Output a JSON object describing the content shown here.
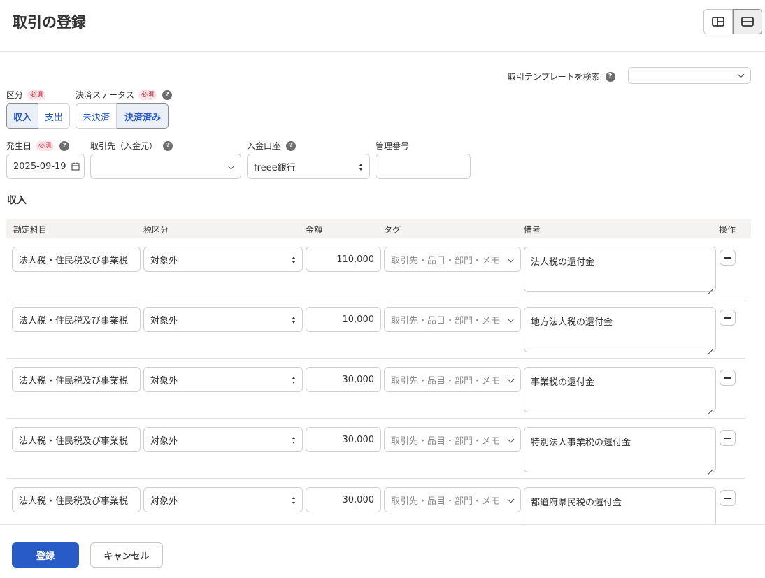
{
  "page": {
    "title": "取引の登録"
  },
  "colors": {
    "accent": "#285ac8",
    "required_bg": "#fde3e6",
    "required_text": "#c8283c"
  },
  "icons": {
    "view_split": "split-view-icon",
    "view_stack": "stacked-view-icon",
    "help": "question-icon",
    "calendar": "calendar-icon"
  },
  "template_search": {
    "label": "取引テンプレートを検索",
    "value": ""
  },
  "type": {
    "label": "区分",
    "required": "必須",
    "options": [
      "収入",
      "支出"
    ],
    "selected": "収入"
  },
  "status": {
    "label": "決済ステータス",
    "required": "必須",
    "options": [
      "未決済",
      "決済済み"
    ],
    "selected": "決済済み"
  },
  "date": {
    "label": "発生日",
    "required": "必須",
    "value": "2025-09-19"
  },
  "partner": {
    "label": "取引先（入金元）",
    "value": ""
  },
  "account": {
    "label": "入金口座",
    "value": "freee銀行"
  },
  "mgmt": {
    "label": "管理番号",
    "value": ""
  },
  "section": {
    "title": "収入"
  },
  "columns": {
    "account": "勘定科目",
    "tax": "税区分",
    "amount": "金額",
    "tag": "タグ",
    "memo": "備考",
    "ops": "操作"
  },
  "rows": [
    {
      "account": "法人税・住民税及び事業税",
      "tax": "対象外",
      "amount": "110,000",
      "tag_placeholder": "取引先・品目・部門・メモ",
      "memo": "法人税の還付金"
    },
    {
      "account": "法人税・住民税及び事業税",
      "tax": "対象外",
      "amount": "10,000",
      "tag_placeholder": "取引先・品目・部門・メモ",
      "memo": "地方法人税の還付金"
    },
    {
      "account": "法人税・住民税及び事業税",
      "tax": "対象外",
      "amount": "30,000",
      "tag_placeholder": "取引先・品目・部門・メモ",
      "memo": "事業税の還付金"
    },
    {
      "account": "法人税・住民税及び事業税",
      "tax": "対象外",
      "amount": "30,000",
      "tag_placeholder": "取引先・品目・部門・メモ",
      "memo": "特別法人事業税の還付金"
    },
    {
      "account": "法人税・住民税及び事業税",
      "tax": "対象外",
      "amount": "30,000",
      "tag_placeholder": "取引先・品目・部門・メモ",
      "memo": "都道府県民税の還付金"
    }
  ],
  "footer": {
    "submit": "登録",
    "cancel": "キャンセル"
  }
}
